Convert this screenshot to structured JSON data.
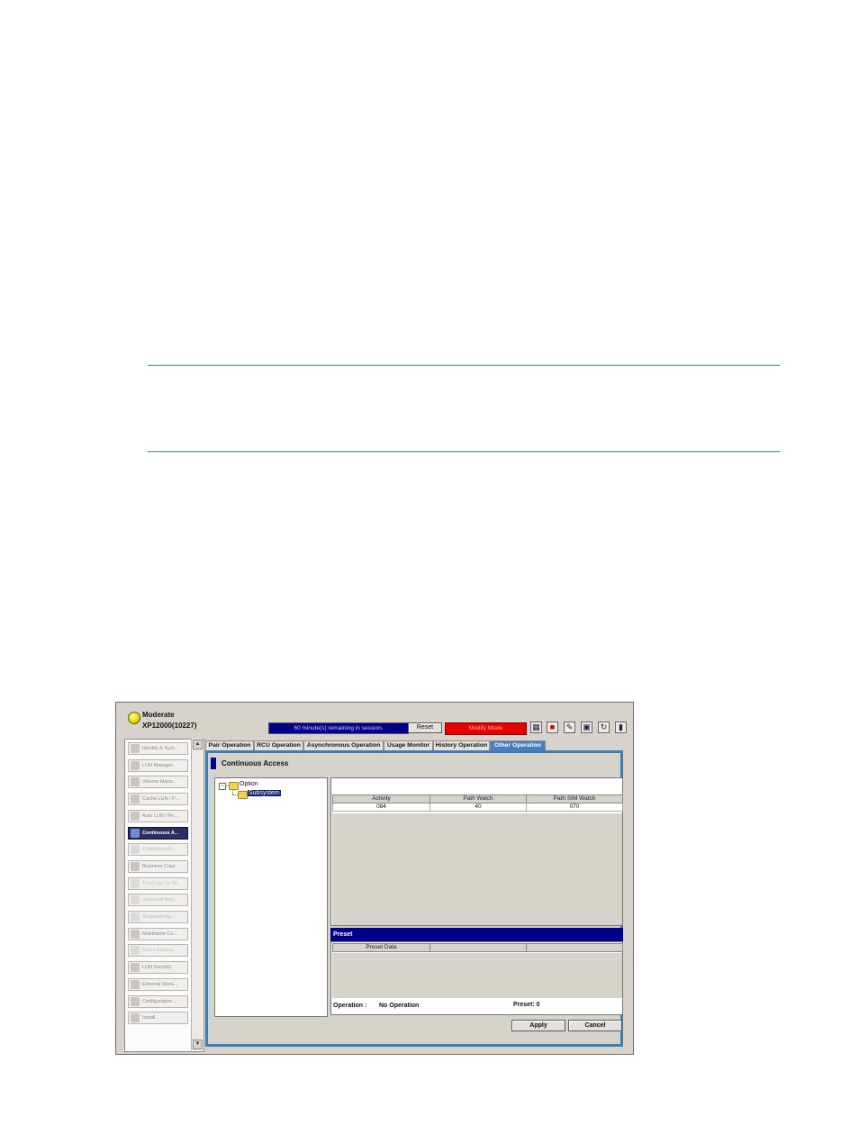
{
  "header": {
    "status": "Moderate",
    "system": "XP12000(10227)",
    "session_text": "60 minute(s) remaining in session.",
    "reset_label": "Reset",
    "mode_label": "Modify Mode"
  },
  "toolbar_icons": [
    "save-icon",
    "floppy-icon",
    "edit-icon",
    "window-icon",
    "refresh-icon",
    "exit-icon"
  ],
  "sidebar": {
    "items": [
      {
        "label": "Identify & Syst..."
      },
      {
        "label": "LUN Manager"
      },
      {
        "label": "Volume Mana..."
      },
      {
        "label": "Cache LUN / P..."
      },
      {
        "label": "Auto LUN / Pe..."
      },
      {
        "label": "Continuous A..."
      },
      {
        "label": "Continuous A..."
      },
      {
        "label": "Business Copy"
      },
      {
        "label": "TrueCopy for IO..."
      },
      {
        "label": "Universal Rep..."
      },
      {
        "label": "ShadowImag..."
      },
      {
        "label": "Mainframe Co..."
      },
      {
        "label": "Direct Backup..."
      },
      {
        "label": "LUN Security"
      },
      {
        "label": "External Stora..."
      },
      {
        "label": "Configuration ..."
      },
      {
        "label": "Install"
      }
    ],
    "active_index": 5
  },
  "tabs": [
    {
      "label": "Pair Operation"
    },
    {
      "label": "RCU Operation"
    },
    {
      "label": "Asynchronous Operation"
    },
    {
      "label": "Usage Monitor"
    },
    {
      "label": "History Operation"
    },
    {
      "label": "Other Operation"
    }
  ],
  "panel": {
    "title": "Continuous Access",
    "tree": {
      "root": "Option",
      "child": "Subsystem"
    },
    "grid": {
      "headers": [
        "Activity",
        "Path Watch",
        "Path SIM Watch"
      ],
      "row": [
        "084",
        "40",
        "070"
      ]
    },
    "preset": {
      "bar_label": "Preset",
      "headers": [
        "Preset Data",
        "",
        ""
      ]
    },
    "operation_label": "Operation :",
    "operation_value": "No Operation",
    "preset_count": "Preset: 0",
    "apply_label": "Apply",
    "cancel_label": "Cancel"
  }
}
